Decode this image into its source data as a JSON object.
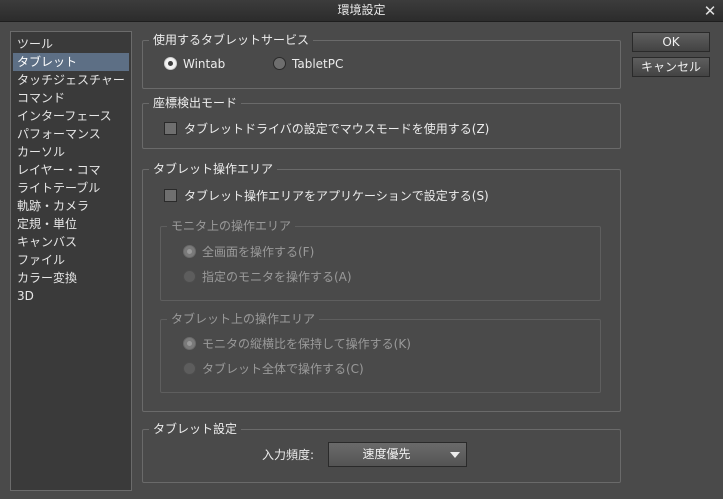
{
  "window": {
    "title": "環境設定",
    "close_glyph": "✕"
  },
  "sidebar": {
    "items": [
      {
        "label": "ツール",
        "selected": false
      },
      {
        "label": "タブレット",
        "selected": true
      },
      {
        "label": "タッチジェスチャー",
        "selected": false
      },
      {
        "label": "コマンド",
        "selected": false
      },
      {
        "label": "インターフェース",
        "selected": false
      },
      {
        "label": "パフォーマンス",
        "selected": false
      },
      {
        "label": "カーソル",
        "selected": false
      },
      {
        "label": "レイヤー・コマ",
        "selected": false
      },
      {
        "label": "ライトテーブル",
        "selected": false
      },
      {
        "label": "軌跡・カメラ",
        "selected": false
      },
      {
        "label": "定規・単位",
        "selected": false
      },
      {
        "label": "キャンバス",
        "selected": false
      },
      {
        "label": "ファイル",
        "selected": false
      },
      {
        "label": "カラー変換",
        "selected": false
      },
      {
        "label": "3D",
        "selected": false
      }
    ]
  },
  "tablet_service": {
    "title": "使用するタブレットサービス",
    "options": [
      {
        "label": "Wintab",
        "checked": true
      },
      {
        "label": "TabletPC",
        "checked": false
      }
    ]
  },
  "coordinate_mode": {
    "title": "座標検出モード",
    "checkbox_label": "タブレットドライバの設定でマウスモードを使用する(Z)",
    "checked": false
  },
  "operation_area": {
    "title": "タブレット操作エリア",
    "checkbox_label": "タブレット操作エリアをアプリケーションで設定する(S)",
    "checked": false,
    "monitor_area": {
      "title": "モニタ上の操作エリア",
      "options": [
        {
          "label": "全画面を操作する(F)",
          "checked": true,
          "enabled": false
        },
        {
          "label": "指定のモニタを操作する(A)",
          "checked": false,
          "enabled": false
        }
      ]
    },
    "tablet_area": {
      "title": "タブレット上の操作エリア",
      "options": [
        {
          "label": "モニタの縦横比を保持して操作する(K)",
          "checked": true,
          "enabled": false
        },
        {
          "label": "タブレット全体で操作する(C)",
          "checked": false,
          "enabled": false
        }
      ]
    }
  },
  "tablet_settings": {
    "title": "タブレット設定",
    "input_frequency_label": "入力頻度:",
    "input_frequency_value": "速度優先"
  },
  "buttons": {
    "ok": "OK",
    "cancel": "キャンセル"
  },
  "colors": {
    "background": "#4a4a4a",
    "sidebar_background": "#3a3a3a",
    "selection": "#5d6f85",
    "titlebar": "#2c2c2c"
  }
}
